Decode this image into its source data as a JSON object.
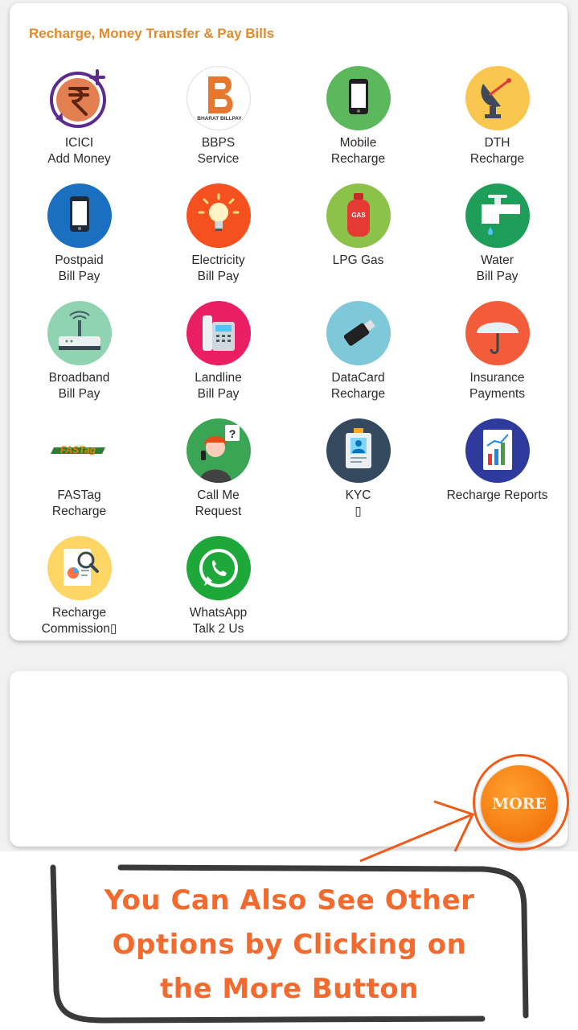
{
  "section_title": "Recharge, Money Transfer & Pay Bills",
  "tiles": [
    {
      "line1": "ICICI",
      "line2": "Add Money",
      "icon": "rupee-add-icon"
    },
    {
      "line1": "BBPS",
      "line2": "Service",
      "icon": "bharat-billpay-icon",
      "logo_text": "BHARAT BILLPAY"
    },
    {
      "line1": "Mobile",
      "line2": "Recharge",
      "icon": "mobile-phone-icon"
    },
    {
      "line1": "DTH",
      "line2": "Recharge",
      "icon": "satellite-dish-icon"
    },
    {
      "line1": "Postpaid",
      "line2": "Bill Pay",
      "icon": "smartphone-icon"
    },
    {
      "line1": "Electricity",
      "line2": "Bill Pay",
      "icon": "light-bulb-icon"
    },
    {
      "line1": "LPG Gas",
      "line2": "",
      "icon": "gas-cylinder-icon",
      "logo_text": "GAS"
    },
    {
      "line1": "Water",
      "line2": "Bill Pay",
      "icon": "water-tap-icon"
    },
    {
      "line1": "Broadband",
      "line2": "Bill Pay",
      "icon": "wifi-router-icon"
    },
    {
      "line1": "Landline",
      "line2": "Bill Pay",
      "icon": "landline-phone-icon"
    },
    {
      "line1": "DataCard",
      "line2": "Recharge",
      "icon": "usb-datacard-icon"
    },
    {
      "line1": "Insurance",
      "line2": "Payments",
      "icon": "umbrella-icon"
    },
    {
      "line1": "FASTag",
      "line2": "Recharge",
      "icon": "fastag-logo-icon",
      "logo_text": "FASTag"
    },
    {
      "line1": "Call Me",
      "line2": "Request",
      "icon": "call-center-agent-icon"
    },
    {
      "line1": "KYC",
      "line2": "▯",
      "icon": "id-card-icon"
    },
    {
      "line1": "Recharge Reports",
      "line2": "",
      "icon": "report-chart-icon"
    },
    {
      "line1": "Recharge",
      "line2": "Commission▯",
      "icon": "commission-search-icon"
    },
    {
      "line1": "WhatsApp",
      "line2": "Talk 2 Us",
      "icon": "whatsapp-icon"
    }
  ],
  "more_button": {
    "label": "MORE"
  },
  "annotation": {
    "line1": "You Can Also See Other",
    "line2": "Options by Clicking on",
    "line3": "the More Button"
  },
  "colors": {
    "title": "#e08a2c",
    "more": "#f4780e",
    "annotation": "#f26a2e"
  }
}
